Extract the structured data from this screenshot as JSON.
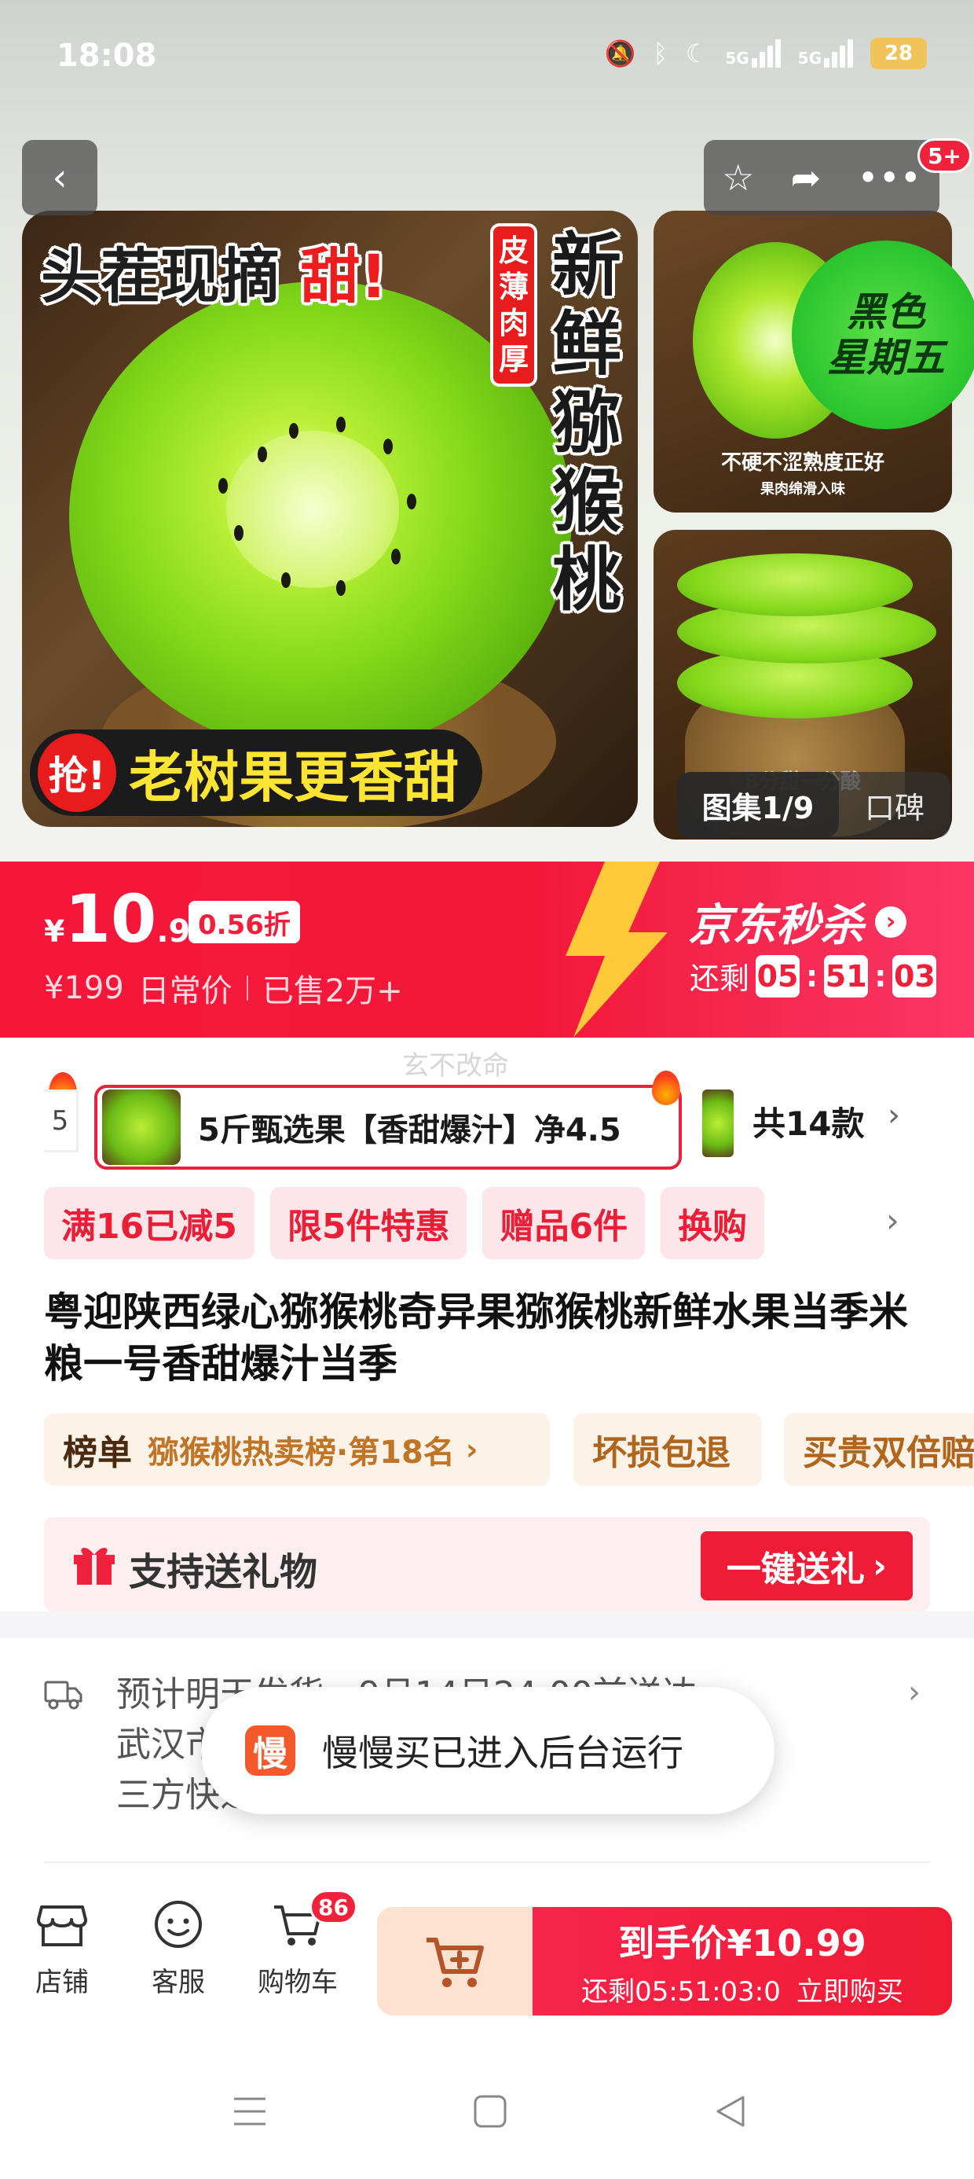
{
  "status_bar": {
    "time": "18:08",
    "battery": "28",
    "signal1": "5G",
    "signal2": "5G"
  },
  "hero": {
    "badge_count": "5+",
    "main_image": {
      "headline_prefix": "头茬现摘",
      "headline_sweet": "甜!",
      "vertical_title": "新鲜猕猴桃",
      "tag": "皮薄肉厚",
      "banner_qiang": "抢!",
      "banner_text": "老树果更香甜"
    },
    "side_image_1": {
      "sticker_line1": "黑色",
      "sticker_line2": "星期五",
      "caption": "不硬不涩熟度正好",
      "caption2": "果肉绵滑入味"
    },
    "side_image_2": {
      "caption": "8分甜一分酸"
    },
    "gallery_count": "图集1/9",
    "gallery_review": "口碑"
  },
  "price": {
    "symbol": "¥",
    "integer": "10",
    "decimal": ".99",
    "discount": "0.56折",
    "original": "¥199",
    "original_label": "日常价",
    "sold": "已售2万+",
    "flash_brand": "京东秒杀",
    "remaining_label": "还剩",
    "countdown": [
      "05",
      "51",
      "03"
    ]
  },
  "watermark": "玄不改命",
  "variants": {
    "edge_char": "5",
    "selected_label": "5斤甄选果【香甜爆汁】净4.5",
    "total": "共14款"
  },
  "promos": [
    "满16已减5",
    "限5件特惠",
    "赠品6件",
    "换购"
  ],
  "product_title": "粤迎陕西绿心猕猴桃奇异果猕猴桃新鲜水果当季米粮一号香甜爆汁当季",
  "rank": {
    "label": "榜单",
    "name": "猕猴桃热卖榜·第18名",
    "tag1": "坏损包退",
    "tag2": "买贵双倍赔"
  },
  "gift": {
    "label": "支持送礼物",
    "button": "一键送礼"
  },
  "delivery": {
    "line1": "预计明天发货，9月14日24:00前送达",
    "line2": "武汉市",
    "line3": "三方快递"
  },
  "toast": {
    "logo": "慢",
    "text": "慢慢买已进入后台运行"
  },
  "bottom_bar": {
    "store": "店铺",
    "service": "客服",
    "cart": "购物车",
    "cart_badge": "86",
    "buy_title": "到手价¥10.99",
    "buy_countdown": "还剩05:51:03:0",
    "buy_action": "立即购买"
  },
  "colors": {
    "accent": "#f01f3a",
    "promo_bg": "#fde6ea",
    "rank_bg": "#fdf2e8",
    "cart_bg": "#fde2cf"
  }
}
